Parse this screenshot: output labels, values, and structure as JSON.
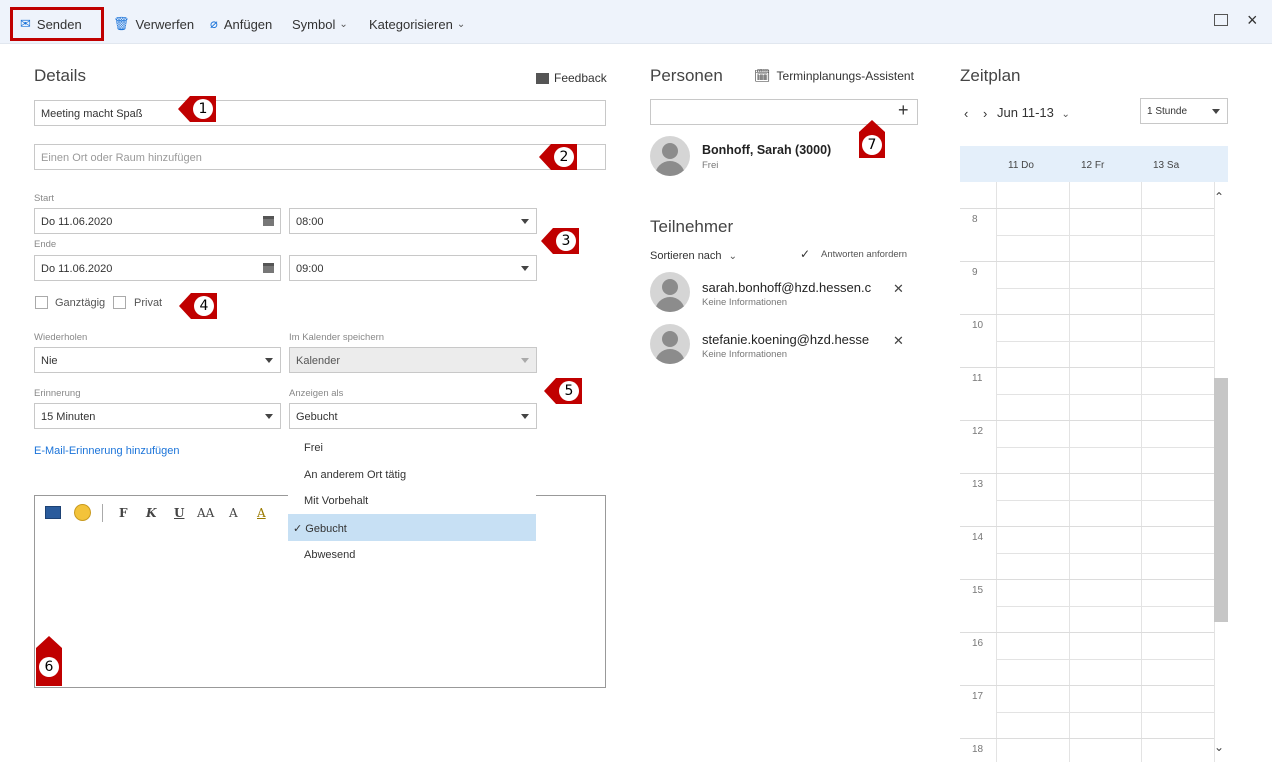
{
  "toolbar": {
    "send": "Senden",
    "discard": "Verwerfen",
    "attach": "Anfügen",
    "symbol": "Symbol",
    "categorize": "Kategorisieren"
  },
  "details": {
    "heading": "Details",
    "feedback": "Feedback",
    "title_value": "Meeting macht Spaß",
    "location_placeholder": "Einen Ort oder Raum hinzufügen",
    "start_label": "Start",
    "start_date": "Do 11.06.2020",
    "start_time": "08:00",
    "end_label": "Ende",
    "end_date": "Do 11.06.2020",
    "end_time": "09:00",
    "all_day": "Ganztägig",
    "private": "Privat",
    "repeat_label": "Wiederholen",
    "repeat_value": "Nie",
    "save_in_label": "Im Kalender speichern",
    "save_in_value": "Kalender",
    "reminder_label": "Erinnerung",
    "reminder_value": "15 Minuten",
    "show_as_label": "Anzeigen als",
    "show_as_value": "Gebucht",
    "email_reminder": "E-Mail-Erinnerung hinzufügen"
  },
  "show_as_options": [
    "Frei",
    "An anderem Ort tätig",
    "Mit Vorbehalt",
    "Gebucht",
    "Abwesend"
  ],
  "show_as_selected_index": 3,
  "editor_tools": [
    "F",
    "K",
    "U",
    "AA",
    "A",
    "A"
  ],
  "people": {
    "heading": "Personen",
    "scheduling_assistant": "Terminplanungs-Assistent",
    "organizer_name": "Bonhoff, Sarah (3000)",
    "organizer_status": "Frei"
  },
  "attendees": {
    "heading": "Teilnehmer",
    "sort_by": "Sortieren nach",
    "request_responses": "Antworten anfordern",
    "list": [
      {
        "email": "sarah.bonhoff@hzd.hessen.c",
        "info": "Keine Informationen"
      },
      {
        "email": "stefanie.koening@hzd.hesse",
        "info": "Keine Informationen"
      }
    ]
  },
  "schedule": {
    "heading": "Zeitplan",
    "range": "Jun 11-13",
    "interval": "1 Stunde",
    "days": [
      "11 Do",
      "12 Fr",
      "13 Sa"
    ],
    "hours": [
      "8",
      "9",
      "10",
      "11",
      "12",
      "13",
      "14",
      "15",
      "16",
      "17",
      "18"
    ]
  },
  "badges": [
    "1",
    "2",
    "3",
    "4",
    "5",
    "6",
    "7"
  ],
  "colors": {
    "accent": "#1a73d9",
    "marker": "#c00000",
    "toolbar_bg": "#eef3fb",
    "selected_option": "#c7e0f4"
  }
}
